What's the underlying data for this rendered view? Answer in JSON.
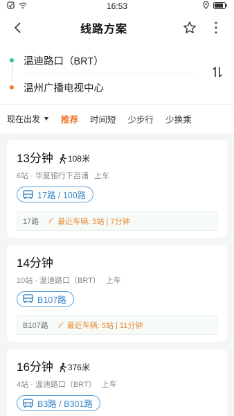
{
  "status_bar": {
    "time": "16:53"
  },
  "header": {
    "title": "线路方案"
  },
  "route": {
    "origin": "温迪路口（BRT）",
    "destination": "温州广播电视中心"
  },
  "filters": {
    "depart": "现在出发",
    "tabs": [
      "推荐",
      "时间短",
      "少步行",
      "少换乘"
    ],
    "active_index": 0
  },
  "colors": {
    "origin_dot": "#2dbf85",
    "destination_dot": "#f07a30",
    "accent": "#f07a30",
    "line_tag": "#3a86c8"
  },
  "plans": [
    {
      "time": "13分钟",
      "walk": "108米",
      "stops": "6站 · 华夏银行下吕浦",
      "board": "上车",
      "lines": "17路 / 100路",
      "rt_line": "17路",
      "rt_info": "最近车辆: 5站 | 7分钟"
    },
    {
      "time": "14分钟",
      "walk": "",
      "stops": "10站 · 温迪路口（BRT）",
      "board": "上车",
      "lines": "B107路",
      "rt_line": "B107路",
      "rt_info": "最近车辆: 5站 | 11分钟"
    },
    {
      "time": "16分钟",
      "walk": "376米",
      "stops": "4站 · 温迪路口（BRT）",
      "board": "上车",
      "lines": "B3路 / B301路",
      "rt_line": "",
      "rt_info": ""
    }
  ]
}
